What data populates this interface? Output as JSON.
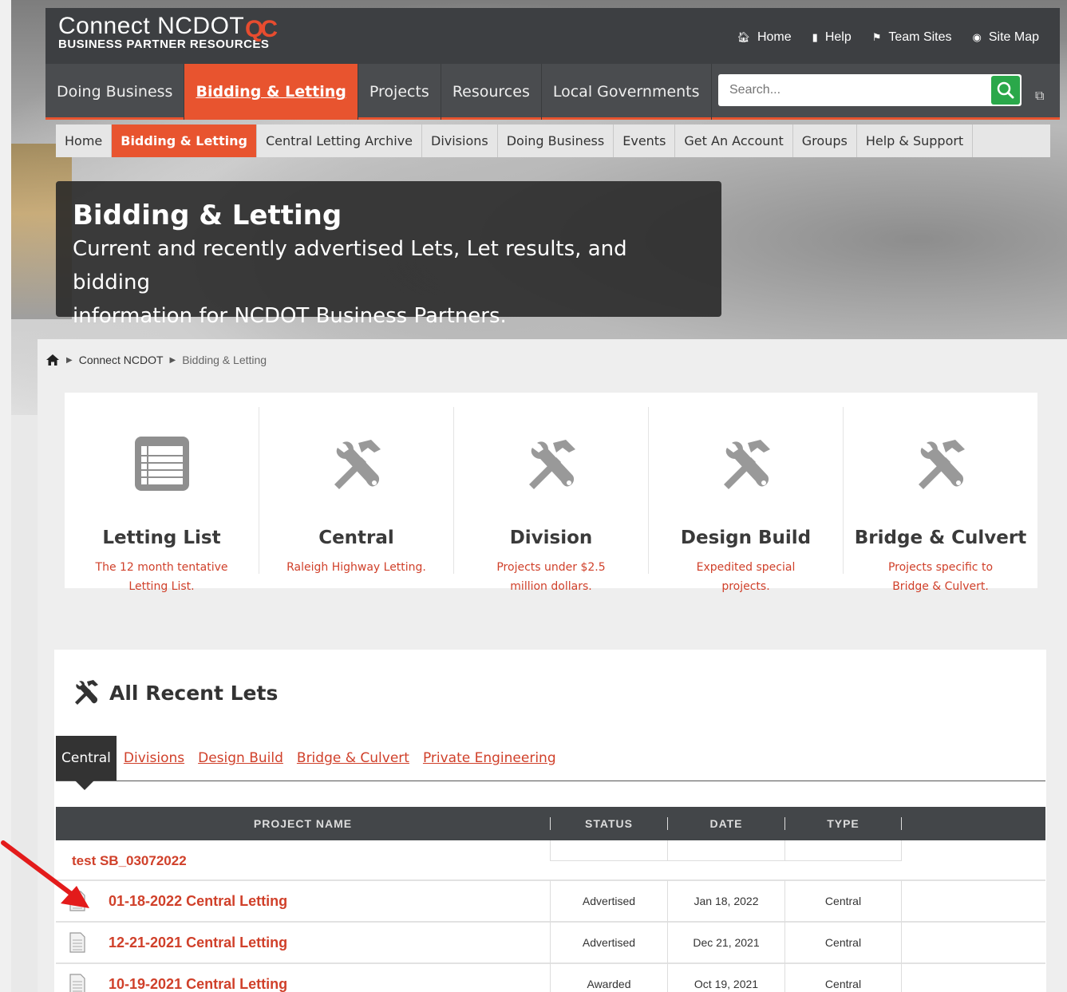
{
  "header": {
    "logo_line1": "Connect NCDOT",
    "logo_line2": "BUSINESS PARTNER RESOURCES",
    "logo_badge": "QC",
    "top_links": [
      {
        "label": "Home",
        "icon": "home-icon"
      },
      {
        "label": "Help",
        "icon": "chat-icon"
      },
      {
        "label": "Team Sites",
        "icon": "flag-icon"
      },
      {
        "label": "Site Map",
        "icon": "globe-icon"
      }
    ]
  },
  "main_nav": {
    "tabs": [
      "Doing Business",
      "Bidding & Letting",
      "Projects",
      "Resources",
      "Local Governments"
    ],
    "active": "Bidding & Letting"
  },
  "search": {
    "placeholder": "Search..."
  },
  "sub_nav": {
    "items": [
      "Home",
      "Bidding & Letting",
      "Central Letting Archive",
      "Divisions",
      "Doing Business",
      "Events",
      "Get An Account",
      "Groups",
      "Help & Support"
    ],
    "active": "Bidding & Letting"
  },
  "hero": {
    "title": "Bidding & Letting",
    "subtitle_line1": "Current and recently advertised Lets, Let results, and bidding",
    "subtitle_line2": "information for NCDOT Business Partners."
  },
  "breadcrumb": {
    "items": [
      "Connect NCDOT",
      "Bidding & Letting"
    ]
  },
  "cards": [
    {
      "title": "Letting List",
      "desc": "The 12 month tentative Letting List.",
      "icon": "list-icon"
    },
    {
      "title": "Central",
      "desc": "Raleigh Highway Letting.",
      "icon": "tools-icon"
    },
    {
      "title": "Division",
      "desc": "Projects under $2.5 million dollars.",
      "icon": "tools-icon"
    },
    {
      "title": "Design Build",
      "desc": "Expedited special projects.",
      "icon": "tools-icon"
    },
    {
      "title": "Bridge & Culvert",
      "desc": "Projects specific to Bridge & Culvert.",
      "icon": "tools-icon"
    }
  ],
  "recent_lets": {
    "title": "All Recent Lets",
    "tabs": [
      "Central",
      "Divisions",
      "Design Build",
      "Bridge & Culvert",
      "Private Engineering"
    ],
    "active_tab": "Central",
    "columns": [
      "PROJECT NAME",
      "STATUS",
      "DATE",
      "TYPE"
    ],
    "group_label": "test SB_03072022",
    "rows": [
      {
        "name": "01-18-2022 Central Letting",
        "status": "Advertised",
        "date": "Jan 18, 2022",
        "type": "Central"
      },
      {
        "name": "12-21-2021 Central Letting",
        "status": "Advertised",
        "date": "Dec 21, 2021",
        "type": "Central"
      },
      {
        "name": "10-19-2021 Central Letting",
        "status": "Awarded",
        "date": "Oct 19, 2021",
        "type": "Central"
      }
    ]
  },
  "colors": {
    "accent": "#e8542f",
    "link": "#d0402a",
    "header": "#3d3f42",
    "search_button": "#2aa84a"
  }
}
